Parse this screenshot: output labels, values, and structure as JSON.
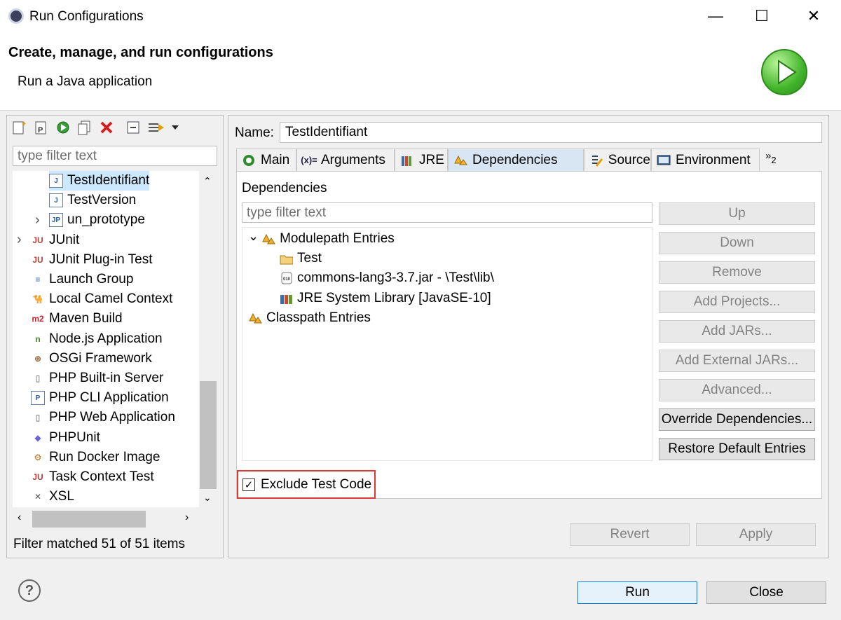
{
  "window": {
    "title": "Run Configurations",
    "minimize_glyph": "—",
    "maximize_glyph": "☐",
    "close_glyph": "✕"
  },
  "header": {
    "title": "Create, manage, and run configurations",
    "subtitle": "Run a Java application",
    "icon": "run-play-icon"
  },
  "left": {
    "toolbar_icons": [
      "new-configuration-icon",
      "new-prototype-icon",
      "export-icon",
      "duplicate-icon",
      "delete-icon",
      "collapse-all-icon",
      "filter-icon",
      "dropdown-icon"
    ],
    "filter_placeholder": "type filter text",
    "tree": [
      {
        "label": "TestIdentifiant",
        "icon": "J",
        "indent": 2,
        "selected": true
      },
      {
        "label": "TestVersion",
        "icon": "J",
        "indent": 2
      },
      {
        "label": "un_prototype",
        "icon": "JP",
        "indent": 2,
        "expander": "›"
      },
      {
        "label": "JUnit",
        "icon": "JU",
        "indent": 1,
        "expander": "›"
      },
      {
        "label": "JUnit Plug-in Test",
        "icon": "JU",
        "indent": 1
      },
      {
        "label": "Launch Group",
        "icon": "≡",
        "indent": 1
      },
      {
        "label": "Local Camel Context",
        "icon": "🐪",
        "indent": 1
      },
      {
        "label": "Maven Build",
        "icon": "m2",
        "indent": 1
      },
      {
        "label": "Node.js Application",
        "icon": "n",
        "indent": 1
      },
      {
        "label": "OSGi Framework",
        "icon": "⊕",
        "indent": 1
      },
      {
        "label": "PHP Built-in Server",
        "icon": "▯",
        "indent": 1
      },
      {
        "label": "PHP CLI Application",
        "icon": "P",
        "indent": 1
      },
      {
        "label": "PHP Web Application",
        "icon": "▯",
        "indent": 1
      },
      {
        "label": "PHPUnit",
        "icon": "◆",
        "indent": 1
      },
      {
        "label": "Run Docker Image",
        "icon": "⚙",
        "indent": 1
      },
      {
        "label": "Task Context Test",
        "icon": "JU",
        "indent": 1
      },
      {
        "label": "XSL",
        "icon": "✕",
        "indent": 1
      }
    ],
    "filter_status": "Filter matched 51 of 51 items"
  },
  "right": {
    "name_label": "Name:",
    "name_value": "TestIdentifiant",
    "tabs": [
      {
        "label": "Main",
        "icon": "main-tab-icon"
      },
      {
        "label": "Arguments",
        "icon": "arguments-tab-icon"
      },
      {
        "label": "JRE",
        "icon": "jre-tab-icon"
      },
      {
        "label": "Dependencies",
        "icon": "dependencies-tab-icon",
        "active": true
      },
      {
        "label": "Source",
        "icon": "source-tab-icon"
      },
      {
        "label": "Environment",
        "icon": "environment-tab-icon"
      }
    ],
    "tab_overflow": "»",
    "tab_overflow_count": "2",
    "dependencies_label": "Dependencies",
    "filter_placeholder": "type filter text",
    "dep_tree": [
      {
        "label": "Modulepath Entries",
        "indent": 0,
        "expanded": true
      },
      {
        "label": "Test",
        "indent": 1
      },
      {
        "label": "commons-lang3-3.7.jar - \\Test\\lib\\",
        "indent": 1
      },
      {
        "label": "JRE System Library [JavaSE-10]",
        "indent": 1
      },
      {
        "label": "Classpath Entries",
        "indent": 0
      }
    ],
    "buttons": [
      {
        "label": "Up",
        "enabled": false
      },
      {
        "label": "Down",
        "enabled": false
      },
      {
        "label": "Remove",
        "enabled": false
      },
      {
        "label": "Add Projects...",
        "enabled": false
      },
      {
        "label": "Add JARs...",
        "enabled": false
      },
      {
        "label": "Add External JARs...",
        "enabled": false
      },
      {
        "label": "Advanced...",
        "enabled": false
      },
      {
        "label": "Override Dependencies...",
        "enabled": true
      },
      {
        "label": "Restore Default Entries",
        "enabled": true
      }
    ],
    "exclude_label": "Exclude Test Code",
    "exclude_checked": true,
    "revert_label": "Revert",
    "apply_label": "Apply"
  },
  "footer": {
    "help_glyph": "?",
    "run_label": "Run",
    "close_label": "Close"
  }
}
